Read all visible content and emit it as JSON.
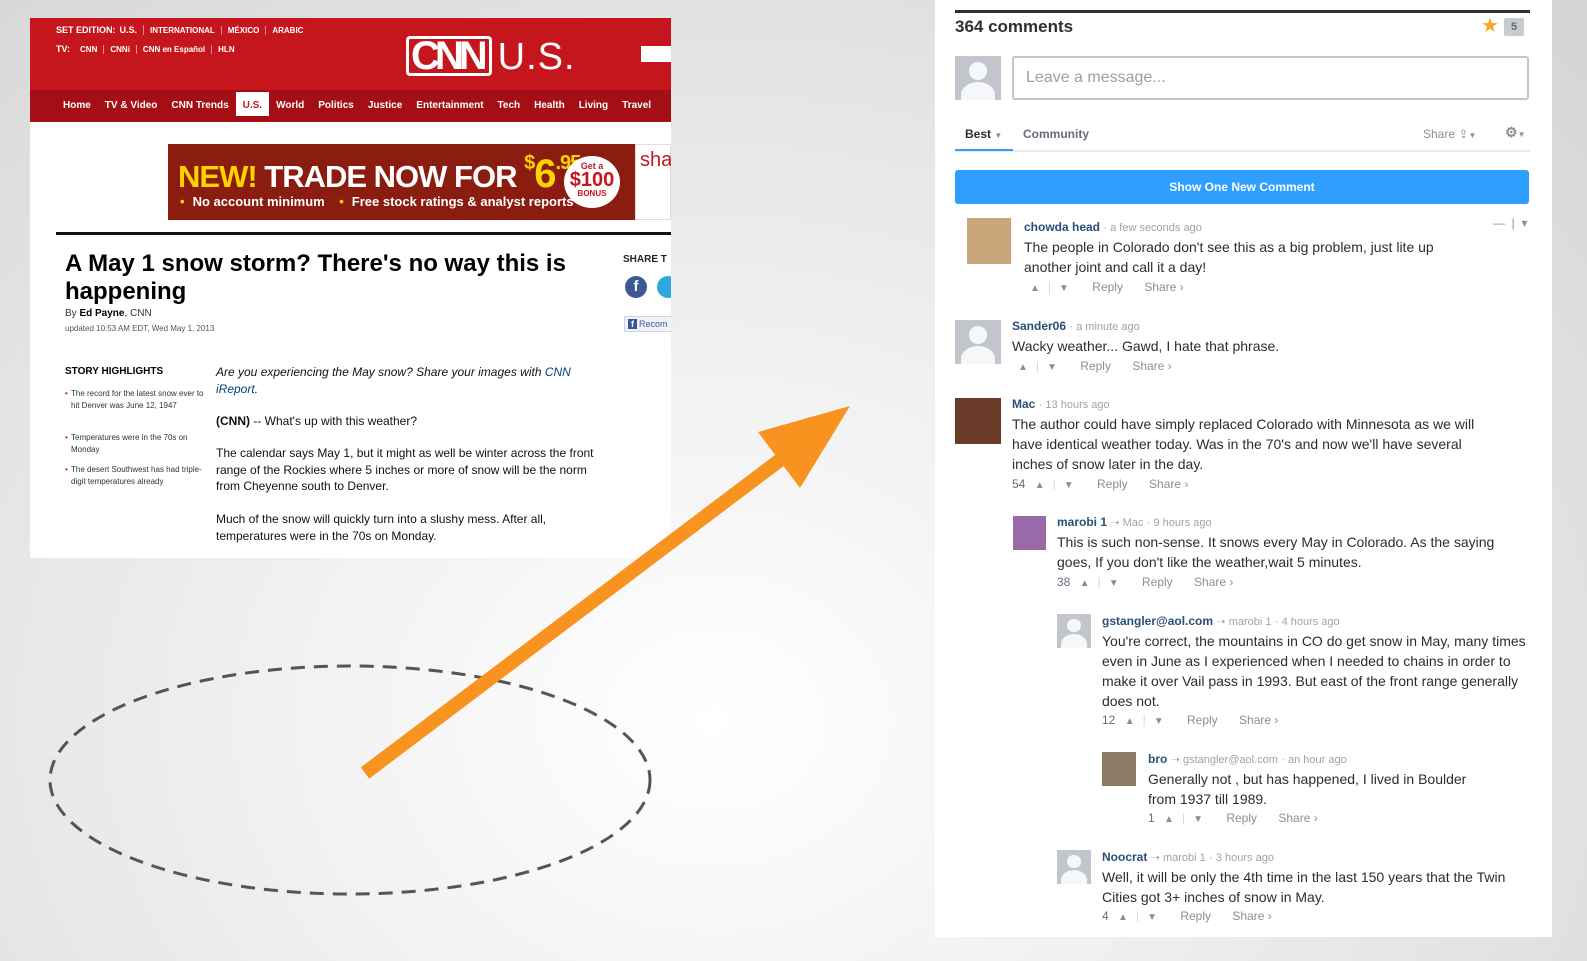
{
  "cnn": {
    "edition_label": "SET EDITION:",
    "edition_current": "U.S.",
    "editions": [
      "INTERNATIONAL",
      "MÉXICO",
      "ARABIC"
    ],
    "tv_label": "TV:",
    "tv_channels": [
      "CNN",
      "CNNi",
      "CNN en Español",
      "HLN"
    ],
    "logo_mark": "CNN",
    "logo_region": "U.S.",
    "nav": [
      "Home",
      "TV & Video",
      "CNN Trends",
      "U.S.",
      "World",
      "Politics",
      "Justice",
      "Entertainment",
      "Tech",
      "Health",
      "Living",
      "Travel"
    ],
    "nav_active": "U.S.",
    "ad": {
      "new": "NEW!",
      "text": "TRADE NOW FOR",
      "dollar": "$",
      "price_whole": "6",
      "price_cents": ".95",
      "badge_top": "Get a",
      "badge_amount": "$100",
      "badge_bottom": "BONUS",
      "bullet1": "No account minimum",
      "bullet2": "Free stock ratings & analyst reports",
      "side_text": "sha"
    },
    "headline": "A May 1 snow storm? There's no way this is happening",
    "byline_prefix": "By",
    "author": "Ed Payne",
    "outlet": ", CNN",
    "updated": "updated 10:53 AM EDT, Wed May 1, 2013",
    "share_label": "SHARE T",
    "recommend": "Recom",
    "highlights_title": "STORY HIGHLIGHTS",
    "highlights": [
      "The record for the latest snow ever to hit Denver was June 12, 1947",
      "Temperatures were in the 70s on Monday",
      "The desert Southwest has had triple-digit temperatures already"
    ],
    "intro_italic": "Are you experiencing the May snow? Share your images with",
    "intro_link": "CNN iReport",
    "para1_dateline": "(CNN)",
    "para1": " -- What's up with this weather?",
    "para2": "The calendar says May 1, but it might as well be winter across the front range of the Rockies where 5 inches or more of snow will be the norm from Cheyenne south to Denver.",
    "para3": "Much of the snow will quickly turn into a slushy mess. After all, temperatures were in the 70s on Monday."
  },
  "disqus": {
    "count": "364 comments",
    "star_count": "5",
    "message_placeholder": "Leave a message...",
    "tab_best": "Best",
    "tab_community": "Community",
    "share_label": "Share",
    "new_comment_button": "Show One New Comment",
    "reply_label": "Reply",
    "share_action": "Share ›",
    "comments": [
      {
        "author": "chowda head",
        "reply_to": "",
        "time": "a few seconds ago",
        "text": "The people in Colorado don't see this as a big problem, just lite up another joint and call it a day!",
        "votes": ""
      },
      {
        "author": "Sander06",
        "reply_to": "",
        "time": "a minute ago",
        "text": "Wacky weather... Gawd, I hate that phrase.",
        "votes": ""
      },
      {
        "author": "Mac",
        "reply_to": "",
        "time": "13 hours ago",
        "text": "The author could have simply replaced Colorado with Minnesota as we will have identical weather today. Was in the 70's and now we'll have several inches of snow later in the day.",
        "votes": "54"
      },
      {
        "author": "marobi 1",
        "reply_to": "Mac",
        "time": "9 hours ago",
        "text": "This is such non-sense. It snows every May in Colorado. As the saying goes, If you don't like the weather,wait 5 minutes.",
        "votes": "38"
      },
      {
        "author": "gstangler@aol.com",
        "reply_to": "marobi 1",
        "time": "4 hours ago",
        "text": "You're correct, the mountains in CO do get snow in May, many times even in June as I experienced when I needed to chains in order to make it over Vail pass in 1993. But east of the front range generally does not.",
        "votes": "12"
      },
      {
        "author": "bro",
        "reply_to": "gstangler@aol.com",
        "time": "an hour ago",
        "text": "Generally not , but has happened, I lived in Boulder from 1937 till 1989.",
        "votes": "1"
      },
      {
        "author": "Noocrat",
        "reply_to": "marobi 1",
        "time": "3 hours ago",
        "text": "Well, it will be only the 4th time in the last 150 years that the Twin Cities got 3+ inches of snow in May.",
        "votes": "4"
      }
    ]
  },
  "colors": {
    "cnn_red": "#c4161c",
    "arrow_orange": "#f7931e",
    "disqus_blue": "#2e9fff",
    "author_blue": "#2a4f77"
  }
}
